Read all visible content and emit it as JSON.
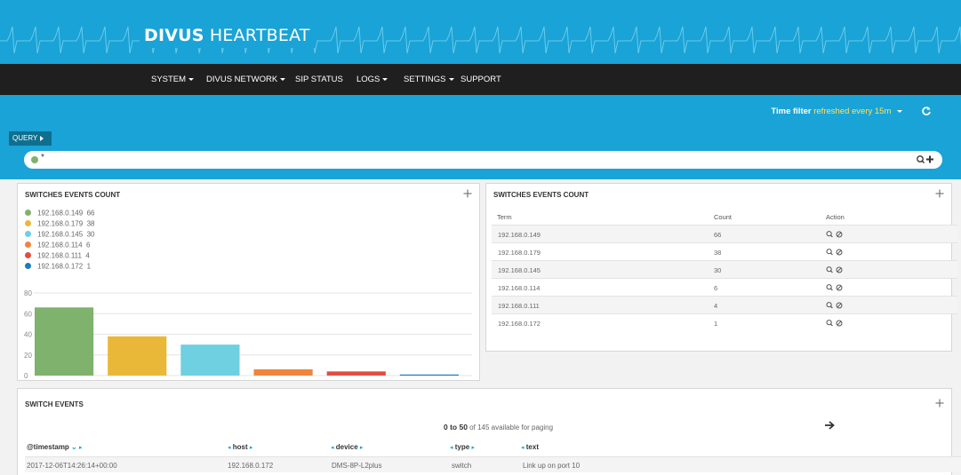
{
  "header": {
    "brand_bold": "DIVUS",
    "brand_light": "HEARTBEAT"
  },
  "nav": {
    "items": [
      {
        "label": "SYSTEM",
        "dropdown": true
      },
      {
        "label": "DIVUS NETWORK",
        "dropdown": true
      },
      {
        "label": "SIP STATUS",
        "dropdown": false
      },
      {
        "label": "LOGS",
        "dropdown": true
      },
      {
        "label": "SETTINGS",
        "dropdown": true
      },
      {
        "label": "SUPPORT",
        "dropdown": false
      }
    ]
  },
  "timefilter": {
    "label": "Time filter",
    "value": "refreshed every 15m",
    "refresh_icon": "refresh-icon"
  },
  "query": {
    "button_label": "QUERY",
    "text": "*",
    "dot_color": "#7eb26d"
  },
  "colors": {
    "accent": "#1aa3d6",
    "navbar": "#1f1f1f",
    "highlight": "#ffe35c"
  },
  "chart_panel": {
    "title": "SWITCHES EVENTS COUNT",
    "legend": [
      {
        "term": "192.168.0.149",
        "count": "66",
        "color": "#7eb26d"
      },
      {
        "term": "192.168.0.179",
        "count": "38",
        "color": "#eab839"
      },
      {
        "term": "192.168.0.145",
        "count": "30",
        "color": "#6ed0e0"
      },
      {
        "term": "192.168.0.114",
        "count": "6",
        "color": "#ef843c"
      },
      {
        "term": "192.168.0.111",
        "count": "4",
        "color": "#e24d42"
      },
      {
        "term": "192.168.0.172",
        "count": "1",
        "color": "#1f78c1"
      }
    ]
  },
  "chart_data": {
    "type": "bar",
    "categories": [
      "192.168.0.149",
      "192.168.0.179",
      "192.168.0.145",
      "192.168.0.114",
      "192.168.0.111",
      "192.168.0.172"
    ],
    "values": [
      66,
      38,
      30,
      6,
      4,
      1
    ],
    "colors": [
      "#7eb26d",
      "#eab839",
      "#6ed0e0",
      "#ef843c",
      "#e24d42",
      "#1f78c1"
    ],
    "title": "SWITCHES EVENTS COUNT",
    "ylim": [
      0,
      80
    ],
    "yticks": [
      "0",
      "20",
      "40",
      "60",
      "80"
    ],
    "grid": true,
    "legend_position": "top-left"
  },
  "table_panel": {
    "title": "SWITCHES EVENTS COUNT",
    "headers": {
      "term": "Term",
      "count": "Count",
      "action": "Action"
    },
    "rows": [
      {
        "term": "192.168.0.149",
        "count": "66"
      },
      {
        "term": "192.168.0.179",
        "count": "38"
      },
      {
        "term": "192.168.0.145",
        "count": "30"
      },
      {
        "term": "192.168.0.114",
        "count": "6"
      },
      {
        "term": "192.168.0.111",
        "count": "4"
      },
      {
        "term": "192.168.0.172",
        "count": "1"
      }
    ]
  },
  "events_panel": {
    "title": "SWITCH EVENTS",
    "pager_range": "0 to 50",
    "pager_rest": "of 145 available for paging",
    "columns": {
      "timestamp": "@timestamp",
      "host": "host",
      "device": "device",
      "type": "type",
      "text": "text"
    },
    "rows": [
      {
        "timestamp": "2017-12-06T14:26:14+00:00",
        "host": "192.168.0.172",
        "device": "DMS-8P-L2plus",
        "type": "switch",
        "text": "Link up on port 10"
      }
    ]
  }
}
